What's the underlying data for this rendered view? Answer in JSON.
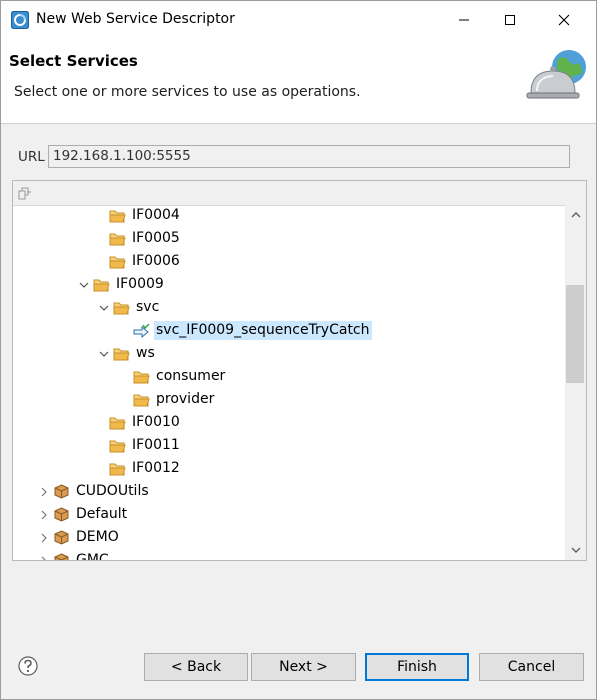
{
  "window": {
    "title": "New Web Service Descriptor"
  },
  "banner": {
    "title": "Select Services",
    "description": "Select one or more services to use as operations."
  },
  "url": {
    "label": "URL",
    "value": "192.168.1.100:5555"
  },
  "tree": {
    "items": [
      {
        "label": "IF0004",
        "icon": "folder-icon",
        "expanded": null
      },
      {
        "label": "IF0005",
        "icon": "folder-icon",
        "expanded": null
      },
      {
        "label": "IF0006",
        "icon": "folder-icon",
        "expanded": null
      },
      {
        "label": "IF0009",
        "icon": "folder-icon",
        "expanded": true
      },
      {
        "label": "svc",
        "icon": "folder-icon",
        "expanded": true
      },
      {
        "label": "svc_IF0009_sequenceTryCatch",
        "icon": "flow-service-icon",
        "expanded": null,
        "selected": true
      },
      {
        "label": "ws",
        "icon": "folder-icon",
        "expanded": true
      },
      {
        "label": "consumer",
        "icon": "folder-icon",
        "expanded": null
      },
      {
        "label": "provider",
        "icon": "folder-icon",
        "expanded": null
      },
      {
        "label": "IF0010",
        "icon": "folder-icon",
        "expanded": null
      },
      {
        "label": "IF0011",
        "icon": "folder-icon",
        "expanded": null
      },
      {
        "label": "IF0012",
        "icon": "folder-icon",
        "expanded": null
      },
      {
        "label": "CUDOUtils",
        "icon": "package-icon",
        "expanded": false
      },
      {
        "label": "Default",
        "icon": "package-icon",
        "expanded": false
      },
      {
        "label": "DEMO",
        "icon": "package-icon",
        "expanded": false
      },
      {
        "label": "GMC",
        "icon": "package-icon",
        "expanded": false
      }
    ]
  },
  "footer": {
    "back_label": "< Back",
    "next_label": "Next >",
    "finish_label": "Finish",
    "cancel_label": "Cancel"
  },
  "colors": {
    "selection": "#cce8ff",
    "folder": "#e8b04a",
    "package": "#c8883a",
    "default_button_border": "#0078d7"
  }
}
